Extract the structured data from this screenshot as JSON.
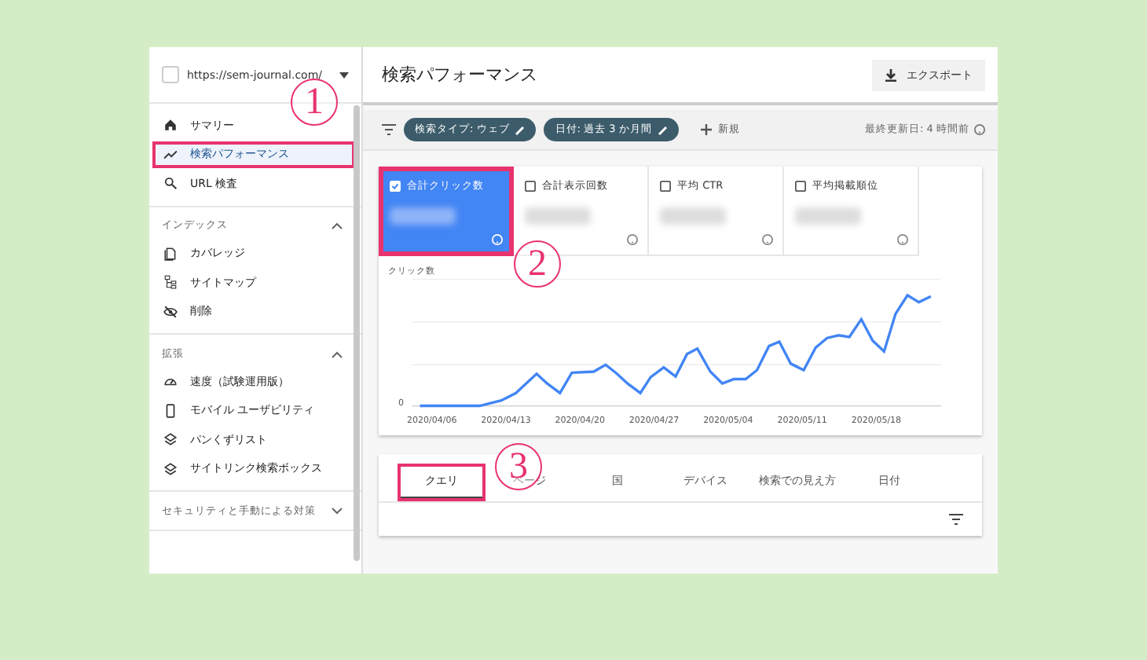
{
  "sidebar": {
    "property": "https://sem-journal.com/",
    "sections": [
      {
        "items": [
          {
            "label": "サマリー",
            "selected": false,
            "highlighted": false
          },
          {
            "label": "検索パフォーマンス",
            "selected": true,
            "highlighted": true
          },
          {
            "label": "URL 検査",
            "selected": false,
            "highlighted": false
          }
        ]
      },
      {
        "title": "インデックス",
        "expanded": true,
        "items": [
          {
            "label": "カバレッジ",
            "selected": false,
            "highlighted": false
          },
          {
            "label": "サイトマップ",
            "selected": false,
            "highlighted": false
          },
          {
            "label": "削除",
            "selected": false,
            "highlighted": false
          }
        ]
      },
      {
        "title": "拡張",
        "expanded": true,
        "items": [
          {
            "label": "速度（試験運用版）",
            "selected": false,
            "highlighted": false
          },
          {
            "label": "モバイル ユーザビリティ",
            "selected": false,
            "highlighted": false
          },
          {
            "label": "パンくずリスト",
            "selected": false,
            "highlighted": false
          },
          {
            "label": "サイトリンク検索ボックス",
            "selected": false,
            "highlighted": false
          }
        ]
      },
      {
        "title": "セキュリティと手動による対策",
        "expanded": false
      }
    ]
  },
  "header": {
    "title": "検索パフォーマンス",
    "export_button": "エクスポート"
  },
  "filters": {
    "chips": [
      "検索タイプ: ウェブ",
      "日付: 過去 3 か月間"
    ],
    "add_button": "新規",
    "updated": "最終更新日: 4 時間前"
  },
  "metrics": [
    {
      "label": "合計クリック数",
      "selected": true,
      "highlighted": true
    },
    {
      "label": "合計表示回数",
      "selected": false,
      "highlighted": false
    },
    {
      "label": "平均 CTR",
      "selected": false,
      "highlighted": false
    },
    {
      "label": "平均掲載順位",
      "selected": false,
      "highlighted": false
    }
  ],
  "chart": {
    "ylabel": "クリック数",
    "y_zero": "0",
    "x_labels": [
      "2020/04/06",
      "2020/04/13",
      "2020/04/20",
      "2020/04/27",
      "2020/05/04",
      "2020/05/11",
      "2020/05/18"
    ]
  },
  "tabs": [
    {
      "label": "クエリ",
      "selected": true,
      "highlighted": true
    },
    {
      "label": "ページ",
      "selected": false,
      "highlighted": false
    },
    {
      "label": "国",
      "selected": false,
      "highlighted": false
    },
    {
      "label": "デバイス",
      "selected": false,
      "highlighted": false
    },
    {
      "label": "検索での見え方",
      "selected": false,
      "highlighted": false
    },
    {
      "label": "日付",
      "selected": false,
      "highlighted": false
    }
  ],
  "annotations": [
    "1",
    "2",
    "3"
  ]
}
